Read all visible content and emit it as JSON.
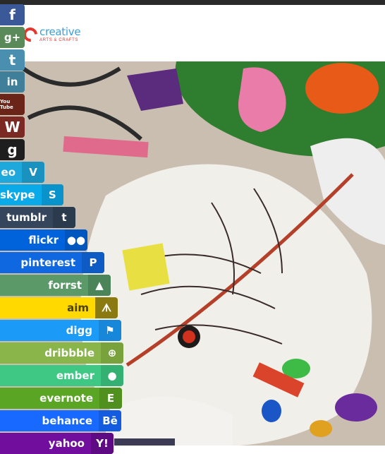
{
  "header": {
    "logo_word": "creative",
    "logo_sub": "ARTS & CRAFTS"
  },
  "share_icons": [
    {
      "name": "facebook",
      "glyph": "f",
      "color": "#3b5998"
    },
    {
      "name": "google-plus",
      "glyph": "g+",
      "color": "#5a8a5a"
    },
    {
      "name": "twitter",
      "glyph": "t",
      "color": "#4a8fb0"
    },
    {
      "name": "linkedin",
      "glyph": "in",
      "color": "#3f7f9a"
    },
    {
      "name": "youtube",
      "glyph": "You Tube",
      "color": "#6b2418"
    },
    {
      "name": "wordpress",
      "glyph": "W",
      "color": "#7a2a22"
    },
    {
      "name": "goodreads",
      "glyph": "g",
      "color": "#1e1e1e"
    }
  ],
  "social_buttons": [
    {
      "key": "vimeo",
      "label": "eo",
      "color": "#1fa8dc",
      "icon_color": "#1a92c0",
      "icon": "V"
    },
    {
      "key": "skype",
      "label": "skype",
      "color": "#0aaae8",
      "icon_color": "#0893ca",
      "icon": "S"
    },
    {
      "key": "tumblr",
      "label": "tumblr",
      "color": "#35465c",
      "icon_color": "#2b3a4d",
      "icon": "t"
    },
    {
      "key": "flickr",
      "label": "flickr",
      "color": "#0063dc",
      "icon_color": "#0056bf",
      "icon": "●●"
    },
    {
      "key": "pinterest",
      "label": "pinterest",
      "color": "#1068e0",
      "icon_color": "#0d5bc3",
      "icon": "P"
    },
    {
      "key": "forrst",
      "label": "forrst",
      "color": "#5b9a68",
      "icon_color": "#4c8459",
      "icon": "▲"
    },
    {
      "key": "aim",
      "label": "aim",
      "color": "#ffd900",
      "icon_color": "#8a7a10",
      "icon": "ᗑ"
    },
    {
      "key": "digg",
      "label": "digg",
      "color": "#1b9af7",
      "icon_color": "#1687d9",
      "icon": "⚑"
    },
    {
      "key": "dribbble",
      "label": "dribbble",
      "color": "#8ab54a",
      "icon_color": "#79a23d",
      "icon": "⊕"
    },
    {
      "key": "ember",
      "label": "ember",
      "color": "#3ec884",
      "icon_color": "#35b073",
      "icon": "●"
    },
    {
      "key": "evernote",
      "label": "evernote",
      "color": "#5ba525",
      "icon_color": "#4f901f",
      "icon": "E"
    },
    {
      "key": "behance",
      "label": "behance",
      "color": "#1769ff",
      "icon_color": "#135ce0",
      "icon": "Bē"
    },
    {
      "key": "yahoo",
      "label": "yahoo",
      "color": "#720e9e",
      "icon_color": "#5e0b83",
      "icon": "Y!"
    }
  ]
}
